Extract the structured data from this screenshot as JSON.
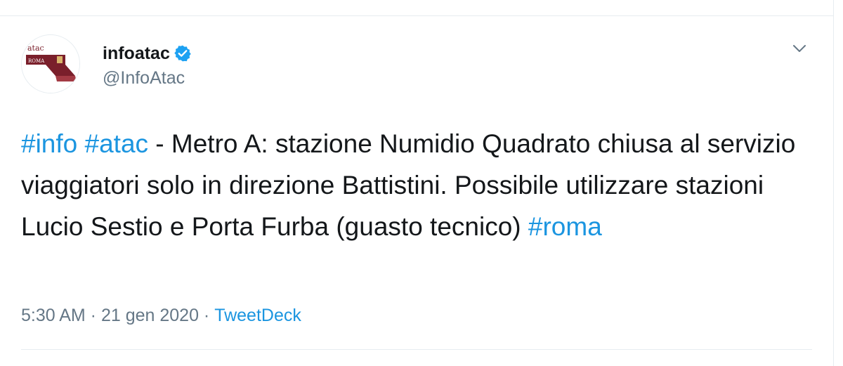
{
  "author": {
    "display_name": "infoatac",
    "handle": "@InfoAtac",
    "verified": true,
    "avatar": {
      "logo_text_top": "atac",
      "logo_text_band": "ROMA"
    }
  },
  "tweet": {
    "hashtag_info": "#info",
    "space_1": " ",
    "hashtag_atac": "#atac",
    "text_body": " - Metro A: stazione Numidio Quadrato chiusa al servizio viaggiatori solo in direzione Battistini. Possibile utilizzare stazioni Lucio Sestio e Porta Furba (guasto tecnico) ",
    "hashtag_roma": "#roma"
  },
  "meta": {
    "time": "5:30 AM",
    "separator_1": " · ",
    "date": "21 gen 2020",
    "separator_2": " · ",
    "source": "TweetDeck"
  },
  "icons": {
    "verified": "verified-badge-icon",
    "caret": "chevron-down-icon"
  },
  "colors": {
    "link": "#1b95e0",
    "verified": "#1da1f2",
    "secondary_text": "#657786",
    "primary_text": "#14171a",
    "logo_maroon": "#7a1f2b"
  }
}
